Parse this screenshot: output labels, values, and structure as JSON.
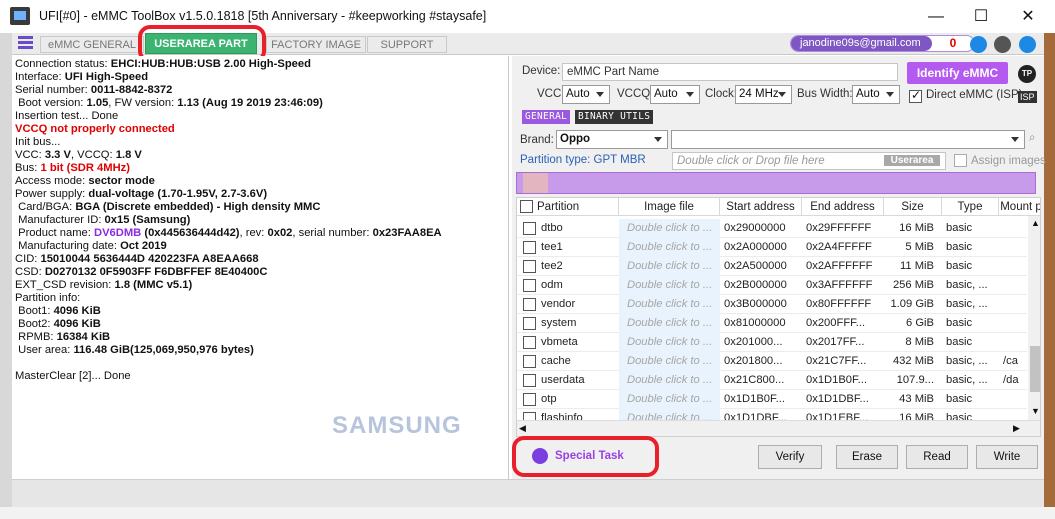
{
  "window": {
    "title": "UFI[#0] - eMMC ToolBox v1.5.0.1818 [5th Anniversary - #keepworking #staysafe]",
    "min": "—",
    "max": "☐",
    "close": "✕"
  },
  "tabs": [
    "eMMC GENERAL",
    "USERAREA PART",
    "FACTORY IMAGE",
    "SUPPORT"
  ],
  "account": {
    "email": "janodine09s@gmail.com",
    "count": "0"
  },
  "log": {
    "l1a": "Connection status: ",
    "l1b": "EHCI:HUB:HUB:USB 2.00 High-Speed",
    "l2a": "Interface: ",
    "l2b": "UFI High-Speed",
    "l3a": "Serial number: ",
    "l3b": "0011-8842-8372",
    "l4a": " Boot version: ",
    "l4b": "1.05",
    ", FW version: ": "",
    "l4c": ", FW version: ",
    "l4d": "1.13 (Aug 19 2019 23:46:09)",
    "l5": "Insertion test... Done",
    "l6": "VCCQ not properly connected",
    "l7": "Init bus...",
    "l8a": "VCC: ",
    "l8b": "3.3 V",
    ", VCCQ: ": "",
    "l8c": ", VCCQ: ",
    "l8d": "1.8 V",
    "l9a": "Bus: ",
    "l9b": "1 bit (SDR 4MHz)",
    "l10a": "Access mode: ",
    "l10b": "sector mode",
    "l11a": "Power supply: ",
    "l11b": "dual-voltage (1.70-1.95V, 2.7-3.6V)",
    "l12a": " Card/BGA: ",
    "l12b": "BGA (Discrete embedded) - High density MMC",
    "l13a": " Manufacturer ID: ",
    "l13b": "0x15 (Samsung)",
    "l14a": " Product name: ",
    "l14b": "DV6DMB",
    "l14c": " (0x445636444d42)",
    "l14d": ", rev: ",
    "l14e": "0x02",
    "l14f": ", serial number: ",
    "l14g": "0x23FAA8EA",
    "l15a": " Manufacturing date: ",
    "l15b": "Oct 2019",
    "l16a": "CID: ",
    "l16b": "15010044 5636444D 420223FA A8EAA668",
    "l17a": "CSD: ",
    "l17b": "D0270132 0F5903FF F6DBFFEF 8E40400C",
    "l18a": "EXT_CSD revision: ",
    "l18b": "1.8 (MMC v5.1)",
    "l19": "Partition info:",
    "l20a": " Boot1: ",
    "l20b": "4096 KiB",
    "l21a": " Boot2: ",
    "l21b": "4096 KiB",
    "l22a": " RPMB: ",
    "l22b": "16384 KiB",
    "l23a": " User area: ",
    "l23b": "116.48 GiB(125,069,950,976 bytes)",
    "l24": "MasterClear [2]... Done"
  },
  "watermark": "SAMSUNG",
  "device": {
    "label": "Device:",
    "value": "eMMC Part Name",
    "identify": "Identify eMMC",
    "tp": "TP"
  },
  "settings": {
    "vcc_label": "VCC:",
    "vcc": "Auto",
    "vccq_label": "VCCQ:",
    "vccq": "Auto",
    "clock_label": "Clock:",
    "clock": "24 MHz",
    "bus_label": "Bus Width:",
    "bus": "Auto",
    "direct": "Direct eMMC (ISP)",
    "isp": "ISP"
  },
  "subtabs": [
    "GENERAL",
    "BINARY UTILS"
  ],
  "brand": {
    "label": "Brand:",
    "value": "Oppo",
    "model": ""
  },
  "partition": {
    "type": "Partition type: GPT MBR",
    "drop": "Double click or Drop file here",
    "userarea": "Userarea",
    "assign": "Assign images"
  },
  "columns": [
    "Partition",
    "Image file",
    "Start address",
    "End address",
    "Size",
    "Type",
    "Mount p"
  ],
  "rows": [
    {
      "name": "dtbo",
      "img": "Double click to ...",
      "start": "0x29000000",
      "end": "0x29FFFFFF",
      "size": "16 MiB",
      "type": "basic",
      "mount": ""
    },
    {
      "name": "tee1",
      "img": "Double click to ...",
      "start": "0x2A000000",
      "end": "0x2A4FFFFF",
      "size": "5 MiB",
      "type": "basic",
      "mount": ""
    },
    {
      "name": "tee2",
      "img": "Double click to ...",
      "start": "0x2A500000",
      "end": "0x2AFFFFFF",
      "size": "11 MiB",
      "type": "basic",
      "mount": ""
    },
    {
      "name": "odm",
      "img": "Double click to ...",
      "start": "0x2B000000",
      "end": "0x3AFFFFFF",
      "size": "256 MiB",
      "type": "basic, ...",
      "mount": ""
    },
    {
      "name": "vendor",
      "img": "Double click to ...",
      "start": "0x3B000000",
      "end": "0x80FFFFFF",
      "size": "1.09 GiB",
      "type": "basic, ...",
      "mount": ""
    },
    {
      "name": "system",
      "img": "Double click to ...",
      "start": "0x81000000",
      "end": "0x200FFF...",
      "size": "6 GiB",
      "type": "basic",
      "mount": ""
    },
    {
      "name": "vbmeta",
      "img": "Double click to ...",
      "start": "0x201000...",
      "end": "0x2017FF...",
      "size": "8 MiB",
      "type": "basic",
      "mount": ""
    },
    {
      "name": "cache",
      "img": "Double click to ...",
      "start": "0x201800...",
      "end": "0x21C7FF...",
      "size": "432 MiB",
      "type": "basic, ...",
      "mount": "/ca"
    },
    {
      "name": "userdata",
      "img": "Double click to ...",
      "start": "0x21C800...",
      "end": "0x1D1B0F...",
      "size": "107.9...",
      "type": "basic, ...",
      "mount": "/da"
    },
    {
      "name": "otp",
      "img": "Double click to ...",
      "start": "0x1D1B0F...",
      "end": "0x1D1DBF...",
      "size": "43 MiB",
      "type": "basic",
      "mount": ""
    },
    {
      "name": "flashinfo",
      "img": "Double click to ...",
      "start": "0x1D1DBF...",
      "end": "0x1D1EBF...",
      "size": "16 MiB",
      "type": "basic",
      "mount": ""
    }
  ],
  "actions": {
    "special": "Special Task",
    "verify": "Verify",
    "erase": "Erase",
    "read": "Read",
    "write": "Write"
  },
  "colors": {
    "accent": "#b55af0",
    "active_tab": "#3cb371",
    "highlight": "#e8202a"
  }
}
